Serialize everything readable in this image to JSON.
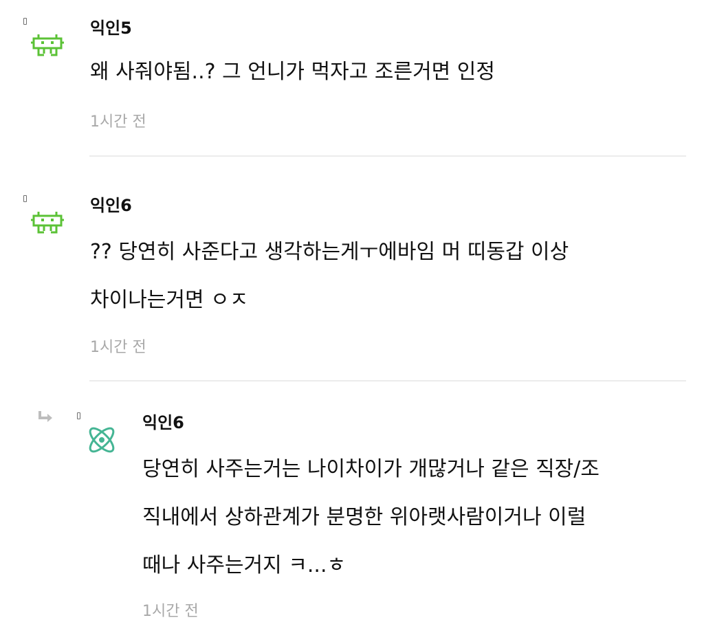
{
  "comments": [
    {
      "author": "익인5",
      "avatar_icon": "green-pixel-invader-icon",
      "lines": [
        "왜 사줘야됨..? 그 언니가 먹자고 조른거면 인정"
      ],
      "time": "1시간 전",
      "is_reply": false
    },
    {
      "author": "익인6",
      "avatar_icon": "green-pixel-invader-icon",
      "lines": [
        "?? 당연히 사준다고 생각하는게ㅜ에바임 머 띠동갑 이상",
        "차이나는거면 ㅇㅈ"
      ],
      "time": "1시간 전",
      "is_reply": false
    },
    {
      "author": "익인6",
      "avatar_icon": "atom-icon",
      "lines": [
        "당연히 사주는거는 나이차이가 개많거나 같은 직장/조",
        "직내에서 상하관계가 분명한 위아랫사람이거나 이럴",
        "때나 사주는거지 ㅋ...ㅎ"
      ],
      "time": "1시간 전",
      "is_reply": true
    }
  ],
  "colors": {
    "invader_green": "#5bc236",
    "atom_teal": "#45b594",
    "time_gray": "#a8a8a8",
    "divider_gray": "#ececec"
  }
}
